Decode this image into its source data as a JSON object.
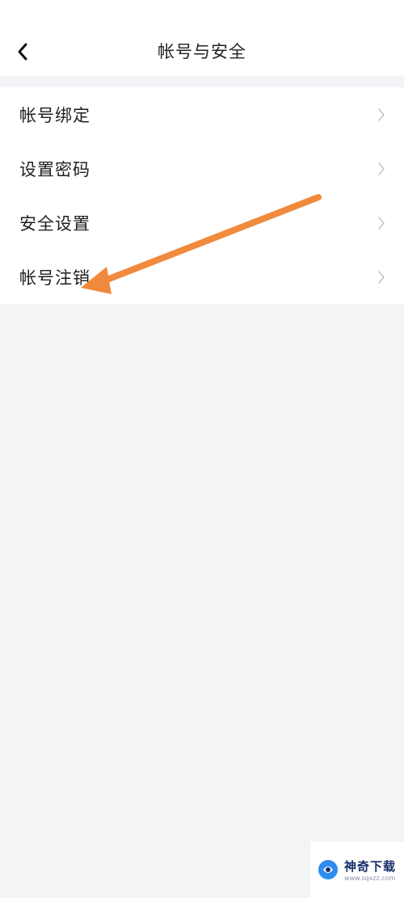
{
  "header": {
    "title": "帐号与安全"
  },
  "menu": {
    "items": [
      {
        "label": "帐号绑定"
      },
      {
        "label": "设置密码"
      },
      {
        "label": "安全设置"
      },
      {
        "label": "帐号注销"
      }
    ]
  },
  "watermark": {
    "name": "神奇下载",
    "url": "www.sqxzz.com"
  },
  "colors": {
    "annotation_arrow": "#f08a3c",
    "background": "#f2f4f6"
  }
}
